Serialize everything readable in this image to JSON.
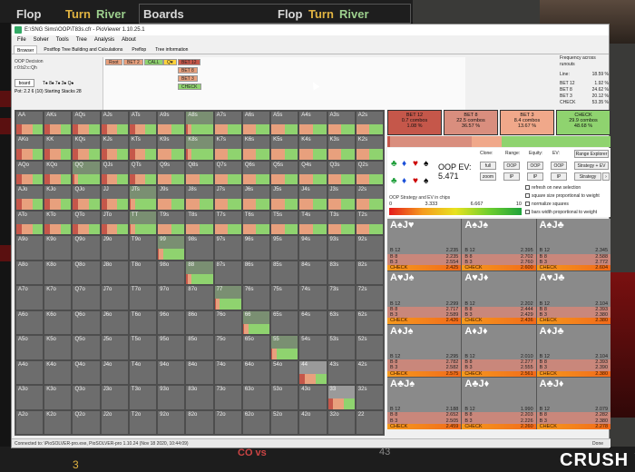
{
  "hud": {
    "flop": "Flop",
    "turn": "Turn",
    "river": "River",
    "boards": "Boards",
    "flop2": "Flop",
    "turn2": "Turn",
    "river2": "River"
  },
  "overlay": {
    "crush": "CRUSH V",
    "bottom_num": "3",
    "bottom_num2": "43",
    "covs": "CO vs"
  },
  "window": {
    "title": "E:\\SNG Sims\\OOP\\T83s.cfr - PioViewer 1.10.25.1",
    "menu": [
      "File",
      "Solver",
      "Tools",
      "Tree",
      "Analysis",
      "About"
    ],
    "tabs": [
      "Browser",
      "Postflop Tree Building and Calculations",
      "Preflop",
      "Tree information"
    ],
    "oop_decision": "OOP Decision",
    "line": "r:0:b2:c:Qh",
    "board_btn": "board",
    "board_cards": "T♠ 8♠ 7♠ 3♠ Q♠",
    "pot_info": "Pot: 2.2 6 (10) Starting Stacks 28",
    "status_text": "Connected to: \\PioSOLVER-pro.exe, PioSOLVER-pro 1.10.24 (Nov 18 2020, 10:44:09)",
    "status_done": "Done"
  },
  "tree": {
    "nodes": [
      {
        "label": "Root",
        "color": "#e8a07d"
      },
      {
        "label": "BET 2",
        "color": "#e8a07d"
      },
      {
        "label": "CALL",
        "color": "#8fd36f"
      },
      {
        "label": "Q♥",
        "color": "#ffd23c"
      },
      {
        "label": "BET 12",
        "color": "#c5574a"
      },
      {
        "label": "BET 8",
        "color": "#e8a07d"
      },
      {
        "label": "BET 3",
        "color": "#e8a07d"
      },
      {
        "label": "CHECK",
        "color": "#8fd36f"
      }
    ]
  },
  "freq": {
    "title": "Frequency across runouts",
    "rows": [
      {
        "k": "Line:",
        "v": "18.59 %"
      },
      {
        "k": "BET 12",
        "v": "1.92 %"
      },
      {
        "k": "BET 8",
        "v": "24.62 %"
      },
      {
        "k": "BET 3",
        "v": "20.12 %"
      },
      {
        "k": "CHECK",
        "v": "53.35 %"
      }
    ]
  },
  "actions": [
    {
      "name": "BET 12",
      "combos": "0.7 combos",
      "pct": "1.08 %",
      "color": "#c5574a"
    },
    {
      "name": "BET 8",
      "combos": "22.5 combos",
      "pct": "36.57 %",
      "color": "#d98e7e"
    },
    {
      "name": "BET 3",
      "combos": "8.4 combos",
      "pct": "13.67 %",
      "color": "#f0a88a"
    },
    {
      "name": "CHECK",
      "combos": "29.9 combos",
      "pct": "48.68 %",
      "color": "#8fd36f"
    }
  ],
  "ev": {
    "label": "OOP EV:",
    "value": "5.471",
    "clone": "Clone:",
    "range": "Range:",
    "equity": "Equity:",
    "ev": "EV:",
    "range_explorer": "Range Explorer",
    "strategy_ev": "Strategy + EV",
    "strategy": "Strategy",
    "full": "full",
    "zoom": "zoom",
    "oop": "OOP",
    "ip": "IP",
    "heat_title": "OOP Strategy and EV in chips",
    "ticks": [
      "0",
      "3.333",
      "6.667",
      "10"
    ],
    "checks": [
      "refresh on new selection",
      "square size proportional to weight",
      "normalize squares",
      "bars width proportional to weight"
    ]
  },
  "grid": [
    [
      "AA",
      "AKs",
      "AQs",
      "AJs",
      "ATs",
      "A9s",
      "A8s",
      "A7s",
      "A6s",
      "A5s",
      "A4s",
      "A3s",
      "A2s"
    ],
    [
      "AKo",
      "KK",
      "KQs",
      "KJs",
      "KTs",
      "K9s",
      "K8s",
      "K7s",
      "K6s",
      "K5s",
      "K4s",
      "K3s",
      "K2s"
    ],
    [
      "AQo",
      "KQo",
      "QQ",
      "QJs",
      "QTs",
      "Q9s",
      "Q8s",
      "Q7s",
      "Q6s",
      "Q5s",
      "Q4s",
      "Q3s",
      "Q2s"
    ],
    [
      "AJo",
      "KJo",
      "QJo",
      "JJ",
      "JTs",
      "J9s",
      "J8s",
      "J7s",
      "J6s",
      "J5s",
      "J4s",
      "J3s",
      "J2s"
    ],
    [
      "ATo",
      "KTo",
      "QTo",
      "JTo",
      "TT",
      "T9s",
      "T8s",
      "T7s",
      "T6s",
      "T5s",
      "T4s",
      "T3s",
      "T2s"
    ],
    [
      "A9o",
      "K9o",
      "Q9o",
      "J9o",
      "T9o",
      "99",
      "98s",
      "97s",
      "96s",
      "95s",
      "94s",
      "93s",
      "92s"
    ],
    [
      "A8o",
      "K8o",
      "Q8o",
      "J8o",
      "T8o",
      "98o",
      "88",
      "87s",
      "86s",
      "85s",
      "84s",
      "83s",
      "82s"
    ],
    [
      "A7o",
      "K7o",
      "Q7o",
      "J7o",
      "T7o",
      "97o",
      "87o",
      "77",
      "76s",
      "75s",
      "74s",
      "73s",
      "72s"
    ],
    [
      "A6o",
      "K6o",
      "Q6o",
      "J6o",
      "T6o",
      "96o",
      "86o",
      "76o",
      "66",
      "65s",
      "64s",
      "63s",
      "62s"
    ],
    [
      "A5o",
      "K5o",
      "Q5o",
      "J5o",
      "T5o",
      "95o",
      "85o",
      "75o",
      "65o",
      "55",
      "54s",
      "53s",
      "52s"
    ],
    [
      "A4o",
      "K4o",
      "Q4o",
      "J4o",
      "T4o",
      "94o",
      "84o",
      "74o",
      "64o",
      "54o",
      "44",
      "43s",
      "42s"
    ],
    [
      "A3o",
      "K3o",
      "Q3o",
      "J3o",
      "T3o",
      "93o",
      "83o",
      "73o",
      "63o",
      "53o",
      "43o",
      "33",
      "32s"
    ],
    [
      "A2o",
      "K2o",
      "Q2o",
      "J2o",
      "T2o",
      "92o",
      "82o",
      "72o",
      "62o",
      "52o",
      "42o",
      "32o",
      "22"
    ]
  ],
  "combos": [
    {
      "hand": "A♠J♥",
      "s1": "#000",
      "s2": "#c00",
      "rows": [
        [
          "B 12",
          "2.235"
        ],
        [
          "B 8",
          "2.235"
        ],
        [
          "B 3",
          "2.554"
        ],
        [
          "CHECK",
          "2.425"
        ]
      ]
    },
    {
      "hand": "A♠J♠",
      "s1": "#000",
      "s2": "#1a4fd8",
      "rows": [
        [
          "B 12",
          "2.395"
        ],
        [
          "B 8",
          "2.702"
        ],
        [
          "B 3",
          "2.760"
        ],
        [
          "CHECK",
          "2.600"
        ]
      ]
    },
    {
      "hand": "A♠J♣",
      "s1": "#000",
      "s2": "#1e9e3a",
      "rows": [
        [
          "B 12",
          "2.345"
        ],
        [
          "B 8",
          "2.588"
        ],
        [
          "B 3",
          "2.772"
        ],
        [
          "CHECK",
          "2.604"
        ]
      ]
    },
    {
      "hand": "A♥J♠",
      "s1": "#c00",
      "s2": "#000",
      "rows": [
        [
          "B 12",
          "2.299"
        ],
        [
          "B 8",
          "2.717"
        ],
        [
          "B 3",
          "2.589"
        ],
        [
          "CHECK",
          "2.426"
        ]
      ]
    },
    {
      "hand": "A♥J♦",
      "s1": "#c00",
      "s2": "#1a4fd8",
      "rows": [
        [
          "B 12",
          "2.202"
        ],
        [
          "B 8",
          "2.444"
        ],
        [
          "B 3",
          "2.429"
        ],
        [
          "CHECK",
          "2.436"
        ]
      ]
    },
    {
      "hand": "A♥J♣",
      "s1": "#c00",
      "s2": "#1e9e3a",
      "rows": [
        [
          "B 12",
          "2.104"
        ],
        [
          "B 8",
          "2.393"
        ],
        [
          "B 3",
          "2.380"
        ],
        [
          "CHECK",
          "2.380"
        ]
      ]
    },
    {
      "hand": "A♦J♠",
      "s1": "#1a4fd8",
      "s2": "#000",
      "rows": [
        [
          "B 12",
          "2.295"
        ],
        [
          "B 8",
          "2.782"
        ],
        [
          "B 3",
          "2.582"
        ],
        [
          "CHECK",
          "2.575"
        ]
      ]
    },
    {
      "hand": "A♦J♦",
      "s1": "#1a4fd8",
      "s2": "#1a4fd8",
      "rows": [
        [
          "B 12",
          "2.010"
        ],
        [
          "B 8",
          "2.277"
        ],
        [
          "B 3",
          "2.555"
        ],
        [
          "CHECK",
          "2.561"
        ]
      ]
    },
    {
      "hand": "A♦J♣",
      "s1": "#1a4fd8",
      "s2": "#1e9e3a",
      "rows": [
        [
          "B 12",
          "2.104"
        ],
        [
          "B 8",
          "2.393"
        ],
        [
          "B 3",
          "2.390"
        ],
        [
          "CHECK",
          "2.380"
        ]
      ]
    },
    {
      "hand": "A♣J♠",
      "s1": "#1e9e3a",
      "s2": "#000",
      "rows": [
        [
          "B 12",
          "2.188"
        ],
        [
          "B 8",
          "2.652"
        ],
        [
          "B 3",
          "2.505"
        ],
        [
          "CHECK",
          "2.459"
        ]
      ]
    },
    {
      "hand": "A♣J♦",
      "s1": "#1e9e3a",
      "s2": "#1a4fd8",
      "rows": [
        [
          "B 12",
          "1.990"
        ],
        [
          "B 8",
          "2.203"
        ],
        [
          "B 3",
          "2.226"
        ],
        [
          "CHECK",
          "2.260"
        ]
      ]
    },
    {
      "hand": "A♣J♦",
      "s1": "#1e9e3a",
      "s2": "#1a4fd8",
      "rows": [
        [
          "B 12",
          "2.079"
        ],
        [
          "B 8",
          "2.282"
        ],
        [
          "B 3",
          "2.380"
        ],
        [
          "CHECK",
          "2.278"
        ]
      ]
    }
  ]
}
